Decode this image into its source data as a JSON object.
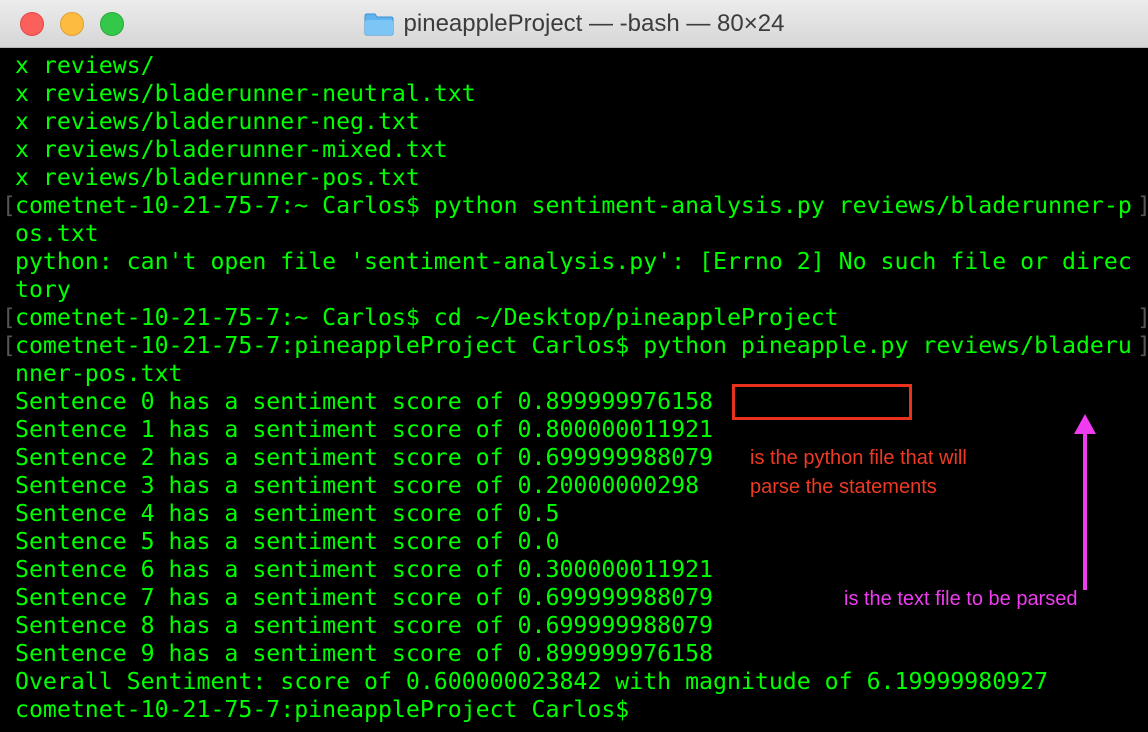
{
  "window": {
    "title": "pineappleProject — -bash — 80×24"
  },
  "terminal": {
    "lines": [
      "x reviews/",
      "x reviews/bladerunner-neutral.txt",
      "x reviews/bladerunner-neg.txt",
      "x reviews/bladerunner-mixed.txt",
      "x reviews/bladerunner-pos.txt",
      "cometnet-10-21-75-7:~ Carlos$ python sentiment-analysis.py reviews/bladerunner-p",
      "os.txt",
      "python: can't open file 'sentiment-analysis.py': [Errno 2] No such file or direc",
      "tory",
      "cometnet-10-21-75-7:~ Carlos$ cd ~/Desktop/pineappleProject",
      "cometnet-10-21-75-7:pineappleProject Carlos$ python pineapple.py reviews/bladeru",
      "nner-pos.txt",
      "Sentence 0 has a sentiment score of 0.899999976158",
      "Sentence 1 has a sentiment score of 0.800000011921",
      "Sentence 2 has a sentiment score of 0.699999988079",
      "Sentence 3 has a sentiment score of 0.20000000298",
      "Sentence 4 has a sentiment score of 0.5",
      "Sentence 5 has a sentiment score of 0.0",
      "Sentence 6 has a sentiment score of 0.300000011921",
      "Sentence 7 has a sentiment score of 0.699999988079",
      "Sentence 8 has a sentiment score of 0.699999988079",
      "Sentence 9 has a sentiment score of 0.899999976158",
      "Overall Sentiment: score of 0.600000023842 with magnitude of 6.19999980927",
      "cometnet-10-21-75-7:pineappleProject Carlos$"
    ]
  },
  "annotations": {
    "python_file_note": "is the python file that will parse the statements",
    "text_file_note": "is the text file to be parsed"
  },
  "colors": {
    "terminal_text": "#00ff00",
    "terminal_bg": "#000000",
    "annotation_red": "#ee3a25",
    "annotation_pink": "#f03cf0"
  }
}
